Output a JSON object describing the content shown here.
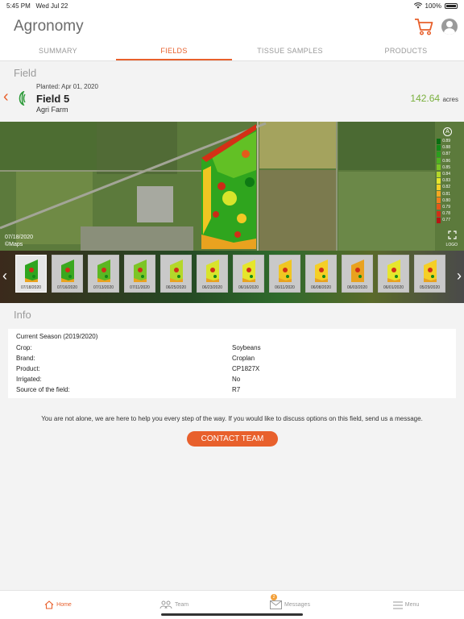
{
  "status": {
    "time": "5:45 PM",
    "date": "Wed Jul 22",
    "battery": "100%"
  },
  "app": {
    "title": "Agronomy",
    "icons": [
      "cart-icon",
      "avatar"
    ]
  },
  "tabs": [
    {
      "label": "SUMMARY",
      "active": false
    },
    {
      "label": "FIELDS",
      "active": true
    },
    {
      "label": "TISSUE SAMPLES",
      "active": false
    },
    {
      "label": "PRODUCTS",
      "active": false
    }
  ],
  "field_section": {
    "title": "Field"
  },
  "field": {
    "planted": "Planted:  Apr 01, 2020",
    "name": "Field 5",
    "farm": "Agri Farm",
    "acres_value": "142.64",
    "acres_unit": "acres"
  },
  "map": {
    "date": "07/18/2020",
    "attribution": "©Maps",
    "compass": "A",
    "logo": "LOGO",
    "legend": [
      {
        "label": "0.89",
        "color": "#0a6e12"
      },
      {
        "label": "0.88",
        "color": "#138a18"
      },
      {
        "label": "0.87",
        "color": "#2a9e1e"
      },
      {
        "label": "0.86",
        "color": "#4fb322"
      },
      {
        "label": "0.85",
        "color": "#7cc526"
      },
      {
        "label": "0.84",
        "color": "#b4d82a"
      },
      {
        "label": "0.83",
        "color": "#e6e62c"
      },
      {
        "label": "0.82",
        "color": "#f5cf26"
      },
      {
        "label": "0.81",
        "color": "#f5a821"
      },
      {
        "label": "0.80",
        "color": "#ef7f1d"
      },
      {
        "label": "0.79",
        "color": "#e4561a"
      },
      {
        "label": "0.78",
        "color": "#d12f17"
      },
      {
        "label": "0.77",
        "color": "#b81414"
      }
    ]
  },
  "thumbnails": [
    {
      "date": "07/18/2020",
      "active": true
    },
    {
      "date": "07/16/2020",
      "active": false
    },
    {
      "date": "07/13/2020",
      "active": false
    },
    {
      "date": "07/11/2020",
      "active": false
    },
    {
      "date": "06/25/2020",
      "active": false
    },
    {
      "date": "06/23/2020",
      "active": false
    },
    {
      "date": "06/16/2020",
      "active": false
    },
    {
      "date": "06/11/2020",
      "active": false
    },
    {
      "date": "06/08/2020",
      "active": false
    },
    {
      "date": "06/03/2020",
      "active": false
    },
    {
      "date": "06/01/2020",
      "active": false
    },
    {
      "date": "05/29/2020",
      "active": false
    }
  ],
  "info": {
    "title": "Info",
    "season": "Current Season (2019/2020)",
    "rows": [
      {
        "label": "Crop:",
        "value": "Soybeans"
      },
      {
        "label": "Brand:",
        "value": "Croplan"
      },
      {
        "label": "Product:",
        "value": "CP1827X"
      },
      {
        "label": "Irrigated:",
        "value": "No"
      },
      {
        "label": "Source of the field:",
        "value": "R7"
      }
    ]
  },
  "help_text": "You are not alone, we are here to help you every step of the way. If you would like to discuss options on this field, send us a message.",
  "contact_button": "CONTACT TEAM",
  "nav": [
    {
      "label": "Home",
      "icon": "home-icon",
      "active": true
    },
    {
      "label": "Team",
      "icon": "team-icon",
      "active": false
    },
    {
      "label": "Messages",
      "icon": "mail-icon",
      "active": false,
      "badge": "2"
    },
    {
      "label": "Menu",
      "icon": "menu-icon",
      "active": false
    }
  ],
  "colors": {
    "accent": "#e8602c",
    "acres": "#7ab03e"
  }
}
